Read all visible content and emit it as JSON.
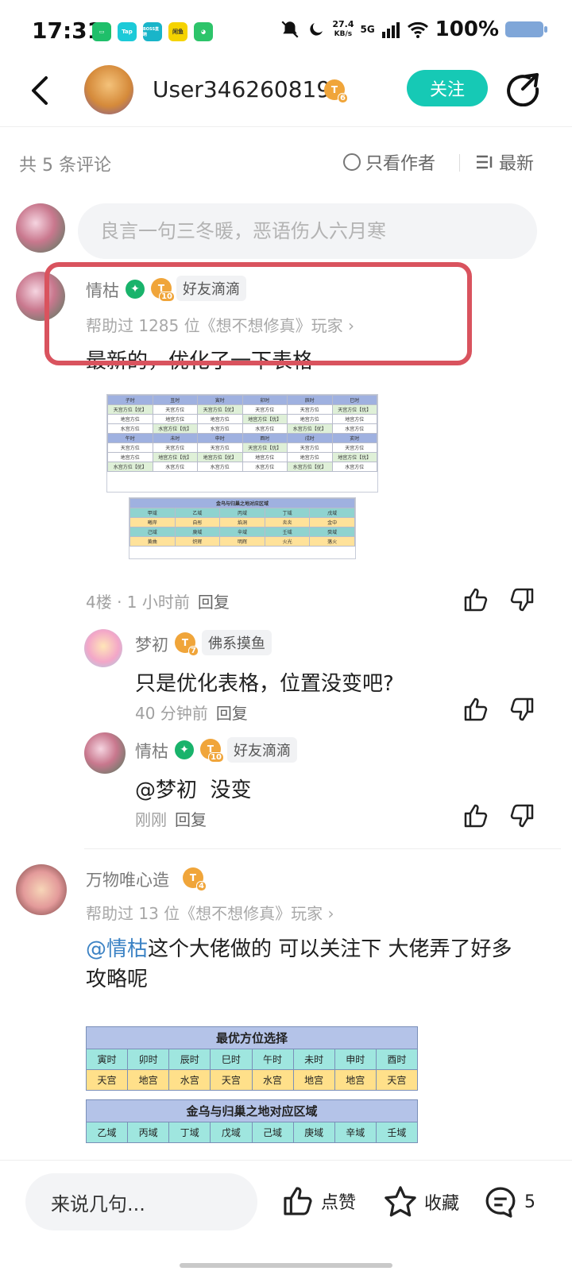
{
  "status": {
    "time": "17:31",
    "app_icons": [
      "Tap",
      "BOSS直聘",
      "闲鱼"
    ],
    "net_speed": "27.4",
    "net_unit": "KB/s",
    "signal": "5G",
    "battery": "100%"
  },
  "header": {
    "username": "User346260819",
    "level": "6",
    "follow_label": "关注"
  },
  "comments_bar": {
    "count_label": "共 5 条评论",
    "only_author_label": "只看作者",
    "sort_label": "最新"
  },
  "input": {
    "placeholder": "良言一句三冬暖，恶语伤人六月寒"
  },
  "comment1": {
    "username": "情枯",
    "level": "10",
    "tag": "好友滴滴",
    "helped": "帮助过 1285 位《想不想修真》玩家 ›",
    "text": "最新的，优化了一下表格",
    "meta": "4楼 · 1 小时前",
    "reply": "回复",
    "table1": {
      "headers_row1": [
        "子时",
        "丑时",
        "寅时",
        "卯时",
        "辰时",
        "巳时"
      ],
      "row1": [
        "天宫方位【优】",
        "天宫方位",
        "天宫方位【优】",
        "天宫方位",
        "天宫方位",
        "天宫方位【优】"
      ],
      "row2": [
        "地宫方位",
        "地宫方位",
        "地宫方位",
        "地宫方位【优】",
        "地宫方位",
        "地宫方位"
      ],
      "row3": [
        "水宫方位",
        "水宫方位【优】",
        "水宫方位",
        "水宫方位",
        "水宫方位【优】",
        "水宫方位"
      ],
      "headers_row2": [
        "午时",
        "未时",
        "申时",
        "酉时",
        "戌时",
        "亥时"
      ],
      "row4": [
        "天宫方位",
        "天宫方位",
        "天宫方位",
        "天宫方位【优】",
        "天宫方位",
        "天宫方位"
      ],
      "row5": [
        "地宫方位",
        "地宫方位【优】",
        "地宫方位【优】",
        "地宫方位",
        "地宫方位",
        "地宫方位【优】"
      ],
      "row6": [
        "水宫方位【优】",
        "水宫方位",
        "水宫方位",
        "水宫方位",
        "水宫方位【优】",
        "水宫方位"
      ]
    },
    "table2": {
      "title": "金乌与归巢之地对应区域",
      "r1": [
        "甲域",
        "乙域",
        "丙域",
        "丁域",
        "戊域"
      ],
      "r2": [
        "曦岸",
        "自彤",
        "焰洞",
        "炎炎",
        "金中"
      ],
      "r3": [
        "己域",
        "庚域",
        "辛域",
        "壬域",
        "癸域"
      ],
      "r4": [
        "黄曲",
        "炽辉",
        "明辉",
        "火光",
        "落火"
      ]
    }
  },
  "reply1": {
    "username": "梦初",
    "level": "7",
    "tag": "佛系摸鱼",
    "text": "只是优化表格，位置没变吧?",
    "meta": "40 分钟前",
    "reply": "回复"
  },
  "reply2": {
    "username": "情枯",
    "level": "10",
    "tag": "好友滴滴",
    "mention": "@梦初",
    "text": "没变",
    "meta": "刚刚",
    "reply": "回复"
  },
  "comment2": {
    "username": "万物唯心造",
    "level": "4",
    "helped": "帮助过 13 位《想不想修真》玩家 ›",
    "mention": "@情枯",
    "text_line1": "这个大佬做的 可以关注下 大佬弄了好多",
    "text_line2": "攻略呢",
    "table": {
      "title1": "最优方位选择",
      "times": [
        "寅时",
        "卯时",
        "辰时",
        "巳时",
        "午时",
        "未时",
        "申时",
        "酉时"
      ],
      "palaces": [
        "天宫",
        "地宫",
        "水宫",
        "天宫",
        "水宫",
        "地宫",
        "地宫",
        "天宫"
      ],
      "title2": "金乌与归巢之地对应区域",
      "regions": [
        "乙域",
        "丙域",
        "丁域",
        "戊域",
        "己域",
        "庚域",
        "辛域",
        "壬域"
      ]
    }
  },
  "bottom": {
    "input_label": "来说几句...",
    "like_label": "点赞",
    "fav_label": "收藏",
    "comment_count": "5"
  }
}
